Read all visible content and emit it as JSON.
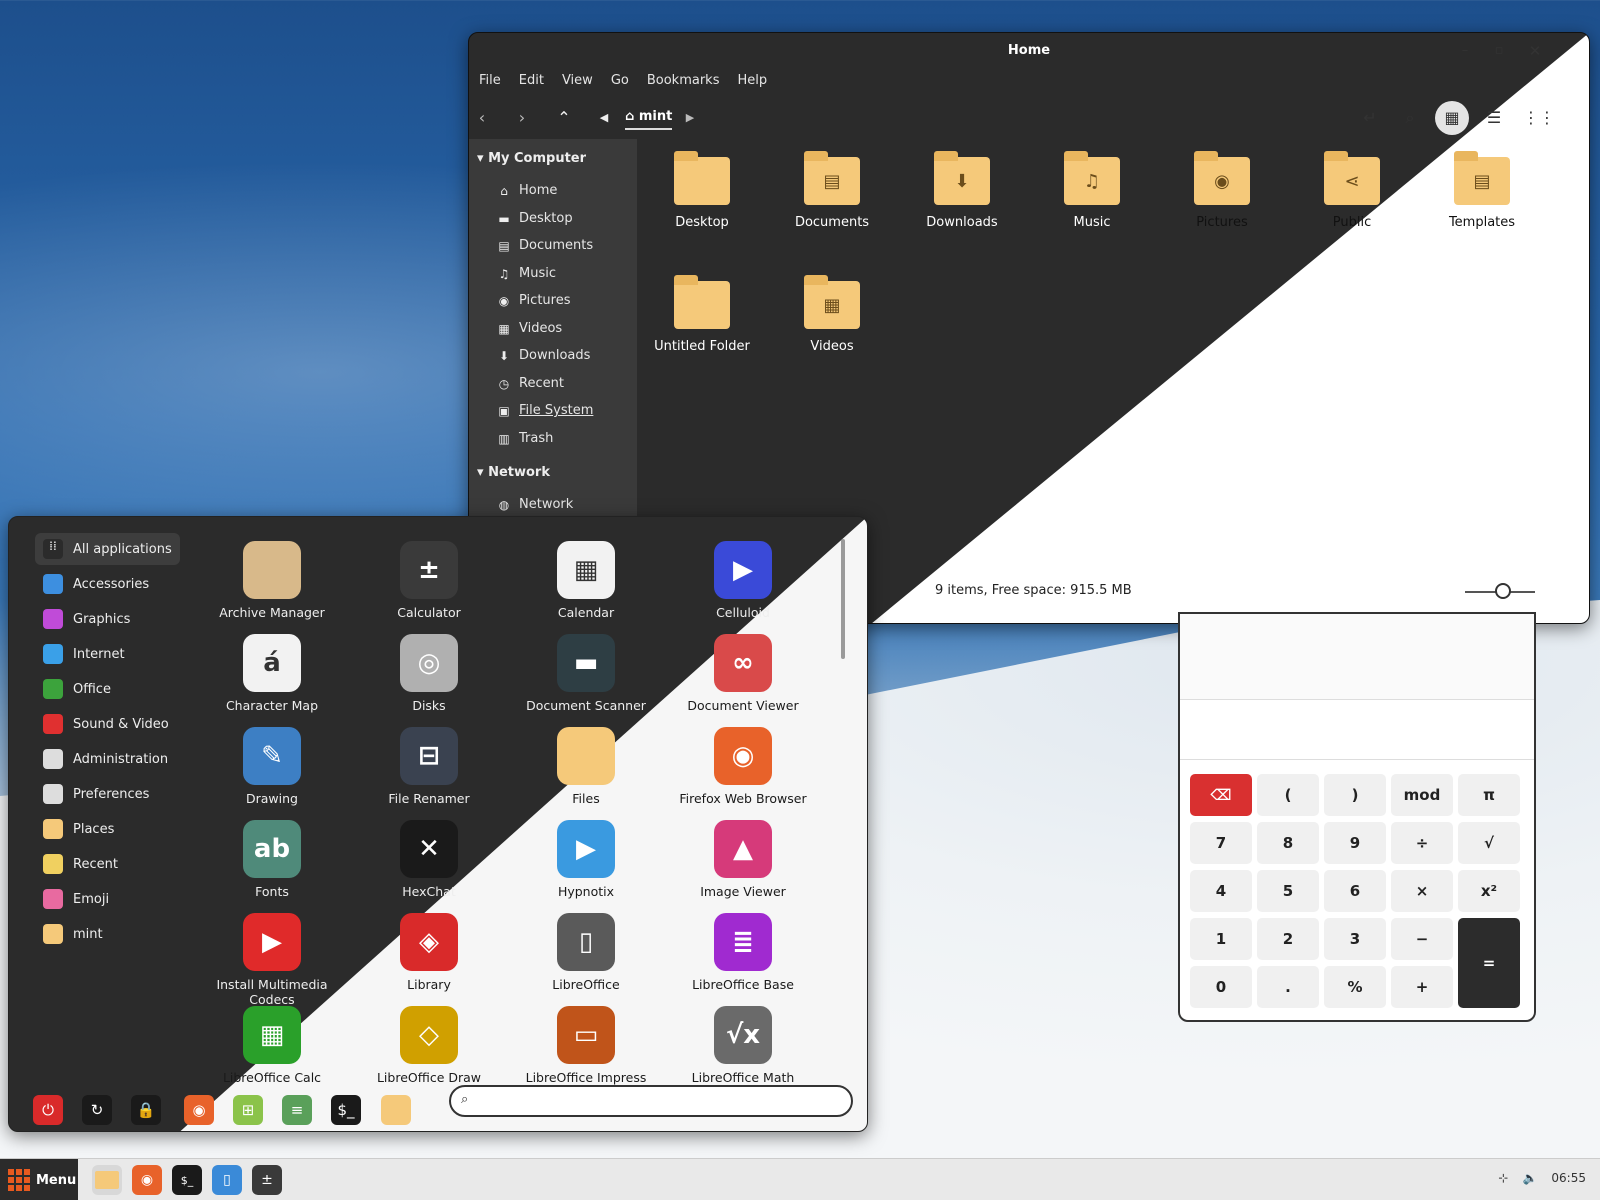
{
  "file_manager": {
    "title": "Home",
    "menu": [
      "File",
      "Edit",
      "View",
      "Go",
      "Bookmarks",
      "Help"
    ],
    "path": "mint",
    "sidebar": {
      "sections": [
        {
          "title": "My Computer",
          "items": [
            {
              "label": "Home",
              "icon": "home-icon"
            },
            {
              "label": "Desktop",
              "icon": "desktop-icon"
            },
            {
              "label": "Documents",
              "icon": "document-icon"
            },
            {
              "label": "Music",
              "icon": "music-icon"
            },
            {
              "label": "Pictures",
              "icon": "camera-icon"
            },
            {
              "label": "Videos",
              "icon": "film-icon"
            },
            {
              "label": "Downloads",
              "icon": "download-icon"
            },
            {
              "label": "Recent",
              "icon": "clock-icon"
            },
            {
              "label": "File System",
              "icon": "drive-icon"
            },
            {
              "label": "Trash",
              "icon": "trash-icon"
            }
          ]
        },
        {
          "title": "Network",
          "items": [
            {
              "label": "Network",
              "icon": "globe-icon"
            }
          ]
        }
      ]
    },
    "items": [
      {
        "label": "Desktop",
        "glyph": ""
      },
      {
        "label": "Documents",
        "glyph": "▤"
      },
      {
        "label": "Downloads",
        "glyph": "⬇"
      },
      {
        "label": "Music",
        "glyph": "♫"
      },
      {
        "label": "Pictures",
        "glyph": "◉"
      },
      {
        "label": "Public",
        "glyph": "⋖"
      },
      {
        "label": "Templates",
        "glyph": "▤"
      },
      {
        "label": "Untitled Folder",
        "glyph": ""
      },
      {
        "label": "Videos",
        "glyph": "▦"
      }
    ],
    "status": "9 items, Free space: 915.5 MB"
  },
  "calculator": {
    "buttons": [
      [
        "⌫",
        "(",
        ")",
        "mod",
        "π"
      ],
      [
        "7",
        "8",
        "9",
        "÷",
        "√"
      ],
      [
        "4",
        "5",
        "6",
        "×",
        "x²"
      ],
      [
        "1",
        "2",
        "3",
        "−",
        "="
      ],
      [
        "0",
        ".",
        "%",
        "+"
      ]
    ]
  },
  "menu": {
    "categories": [
      {
        "label": "All applications",
        "color": "#2b2b2b"
      },
      {
        "label": "Accessories",
        "color": "#3d8fe0"
      },
      {
        "label": "Graphics",
        "color": "#c04bd8"
      },
      {
        "label": "Internet",
        "color": "#3aa0e8"
      },
      {
        "label": "Office",
        "color": "#3ca33c"
      },
      {
        "label": "Sound & Video",
        "color": "#e03030"
      },
      {
        "label": "Administration",
        "color": "#dddddd"
      },
      {
        "label": "Preferences",
        "color": "#dddddd"
      },
      {
        "label": "Places",
        "color": "#f5c97a"
      },
      {
        "label": "Recent",
        "color": "#f0d060"
      },
      {
        "label": "Emoji",
        "color": "#e86aa0"
      },
      {
        "label": "mint",
        "color": "#f5c97a"
      }
    ],
    "apps": [
      {
        "label": "Archive Manager",
        "color": "#d8b98a",
        "glyph": ""
      },
      {
        "label": "Calculator",
        "color": "#3a3a3a",
        "glyph": "±"
      },
      {
        "label": "Calendar",
        "color": "#f2f2f2",
        "glyph": "▦"
      },
      {
        "label": "Celluloid",
        "color": "#3a4ad8",
        "glyph": "▶"
      },
      {
        "label": "Character Map",
        "color": "#f2f2f2",
        "glyph": "á"
      },
      {
        "label": "Disks",
        "color": "#b0b0b0",
        "glyph": "◎"
      },
      {
        "label": "Document Scanner",
        "color": "#2e3e44",
        "glyph": "▬"
      },
      {
        "label": "Document Viewer",
        "color": "#d94a4a",
        "glyph": "∞"
      },
      {
        "label": "Drawing",
        "color": "#3d7fc4",
        "glyph": "✎"
      },
      {
        "label": "File Renamer",
        "color": "#3a4250",
        "glyph": "⊟"
      },
      {
        "label": "Files",
        "color": "#f5c97a",
        "glyph": ""
      },
      {
        "label": "Firefox Web Browser",
        "color": "#e8622a",
        "glyph": "◉"
      },
      {
        "label": "Fonts",
        "color": "#4f8a7a",
        "glyph": "ab"
      },
      {
        "label": "HexChat",
        "color": "#1a1a1a",
        "glyph": "✕"
      },
      {
        "label": "Hypnotix",
        "color": "#3a9ae0",
        "glyph": "▶"
      },
      {
        "label": "Image Viewer",
        "color": "#d63a7a",
        "glyph": "▲"
      },
      {
        "label": "Install Multimedia Codecs",
        "color": "#e02a2a",
        "glyph": "▶"
      },
      {
        "label": "Library",
        "color": "#d92a2a",
        "glyph": "◈"
      },
      {
        "label": "LibreOffice",
        "color": "#5a5a5a",
        "glyph": "▯"
      },
      {
        "label": "LibreOffice Base",
        "color": "#a02ad0",
        "glyph": "≣"
      },
      {
        "label": "LibreOffice Calc",
        "color": "#2aa02a",
        "glyph": "▦"
      },
      {
        "label": "LibreOffice Draw",
        "color": "#d0a000",
        "glyph": "◇"
      },
      {
        "label": "LibreOffice Impress",
        "color": "#c0541a",
        "glyph": "▭"
      },
      {
        "label": "LibreOffice Math",
        "color": "#6a6a6a",
        "glyph": "√x"
      }
    ],
    "favorites": [
      {
        "name": "power-icon",
        "color": "#d92a2a",
        "glyph": "⏻"
      },
      {
        "name": "logout-icon",
        "color": "#1a1a1a",
        "glyph": "↻"
      },
      {
        "name": "lock-icon",
        "color": "#1a1a1a",
        "glyph": "🔒"
      },
      {
        "name": "firefox-icon",
        "color": "#e8622a",
        "glyph": "◉"
      },
      {
        "name": "software-manager-icon",
        "color": "#8bc34a",
        "glyph": "⊞"
      },
      {
        "name": "settings-icon",
        "color": "#5aa05a",
        "glyph": "≡"
      },
      {
        "name": "terminal-icon",
        "color": "#1a1a1a",
        "glyph": "$_"
      },
      {
        "name": "folder-icon",
        "color": "#f5c97a",
        "glyph": ""
      }
    ],
    "search_value": ""
  },
  "taskbar": {
    "menu_label": "Menu",
    "clock": "06:55"
  }
}
